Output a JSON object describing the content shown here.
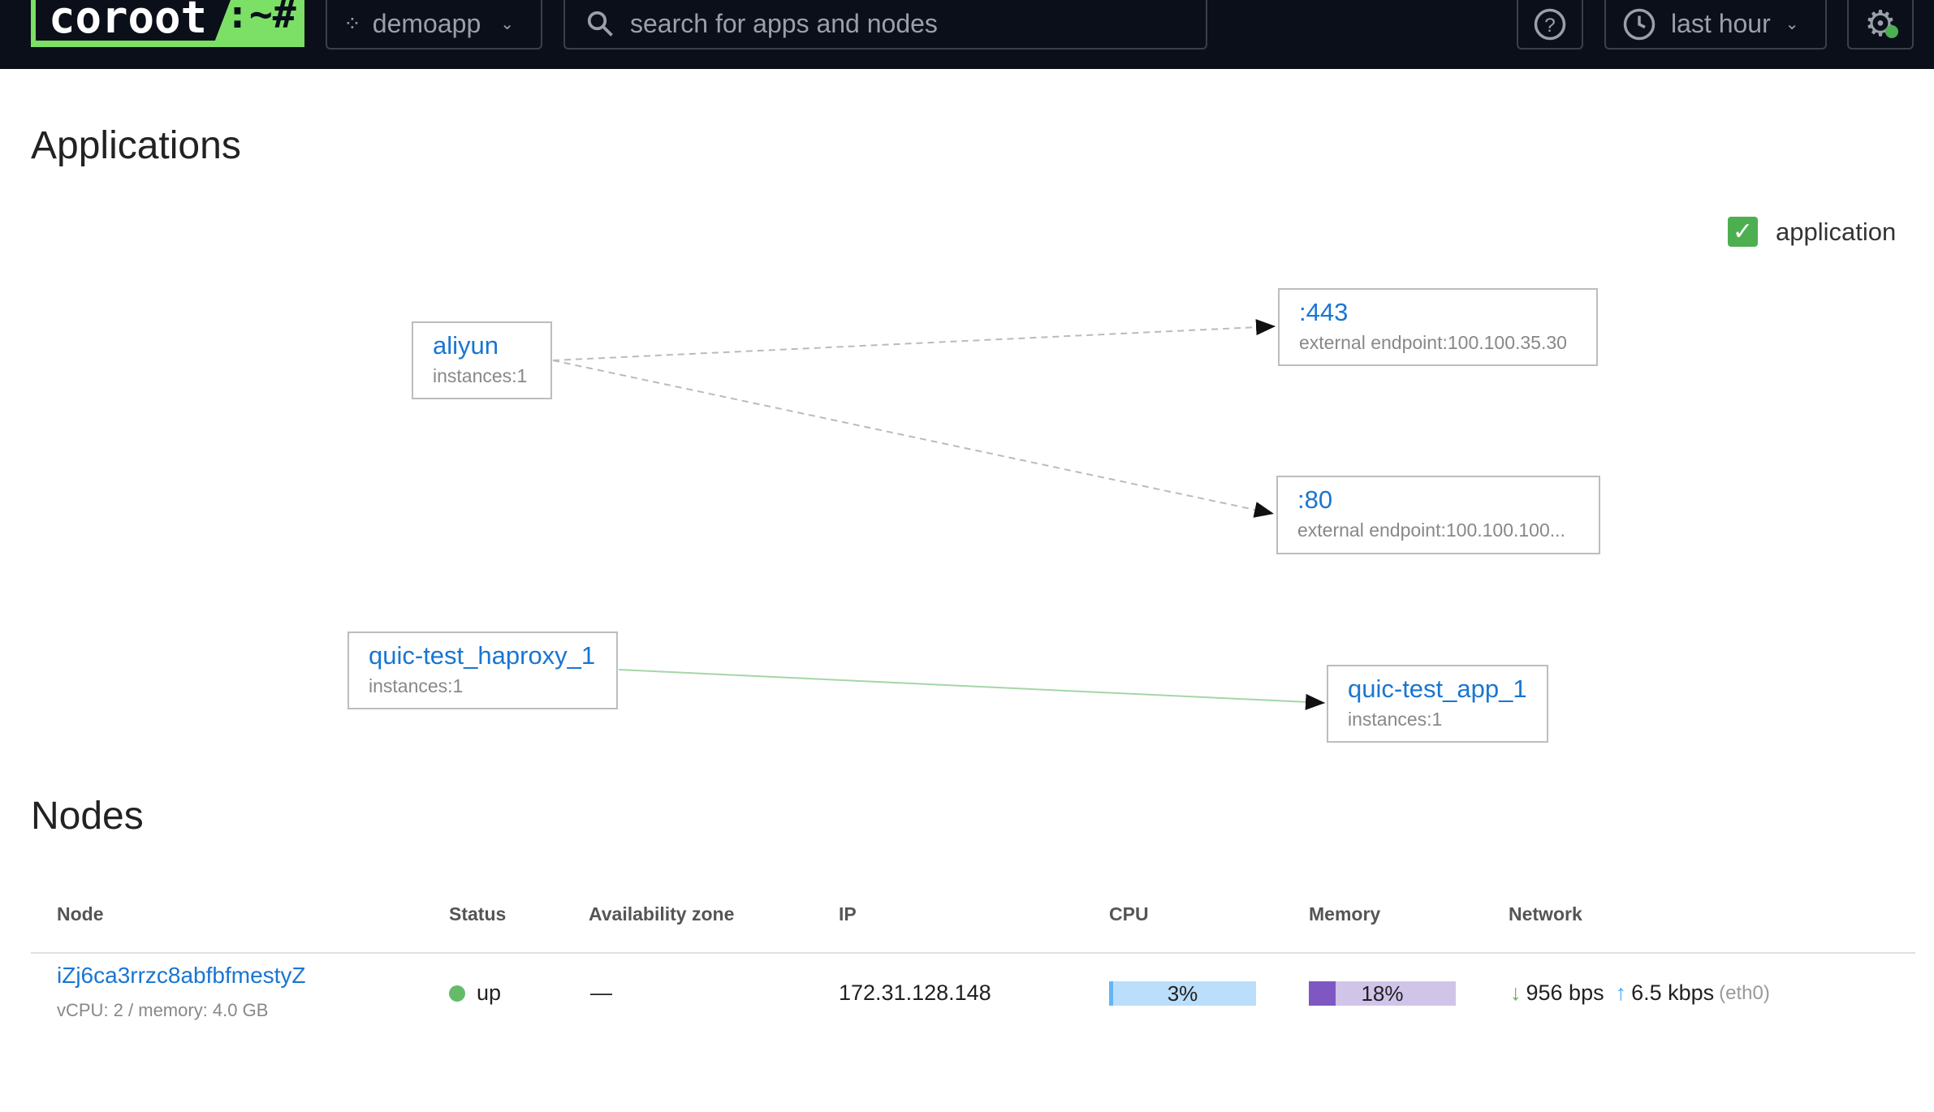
{
  "header": {
    "logo_text": "coroot",
    "logo_suffix": ":~#",
    "project": "demoapp",
    "search_placeholder": "search for apps and nodes",
    "time_range": "last hour"
  },
  "applications": {
    "title": "Applications",
    "legend": {
      "label": "application",
      "checked": true,
      "color": "#4caf50"
    },
    "nodes": [
      {
        "name": "aliyun",
        "sub": "instances:1"
      },
      {
        "name": ":443",
        "sub": "external endpoint:100.100.35.30"
      },
      {
        "name": ":80",
        "sub": "external endpoint:100.100.100..."
      },
      {
        "name": "quic-test_haproxy_1",
        "sub": "instances:1"
      },
      {
        "name": "quic-test_app_1",
        "sub": "instances:1"
      }
    ],
    "edges": [
      {
        "from": "aliyun",
        "to": ":443",
        "style": "dashed"
      },
      {
        "from": "aliyun",
        "to": ":80",
        "style": "dashed"
      },
      {
        "from": "quic-test_haproxy_1",
        "to": "quic-test_app_1",
        "style": "solid-green"
      }
    ]
  },
  "nodes": {
    "title": "Nodes",
    "columns": [
      "Node",
      "Status",
      "Availability zone",
      "IP",
      "CPU",
      "Memory",
      "Network"
    ],
    "rows": [
      {
        "name": "iZj6ca3rrzc8abfbfmestyZ",
        "sub": "vCPU: 2 / memory: 4.0 GB",
        "status": "up",
        "status_color": "#66bb6a",
        "zone": "—",
        "ip": "172.31.128.148",
        "cpu": "3%",
        "cpu_pct": 3,
        "memory": "18%",
        "memory_pct": 18,
        "net_in": "956 bps",
        "net_out": "6.5 kbps",
        "iface": "(eth0)"
      }
    ]
  }
}
